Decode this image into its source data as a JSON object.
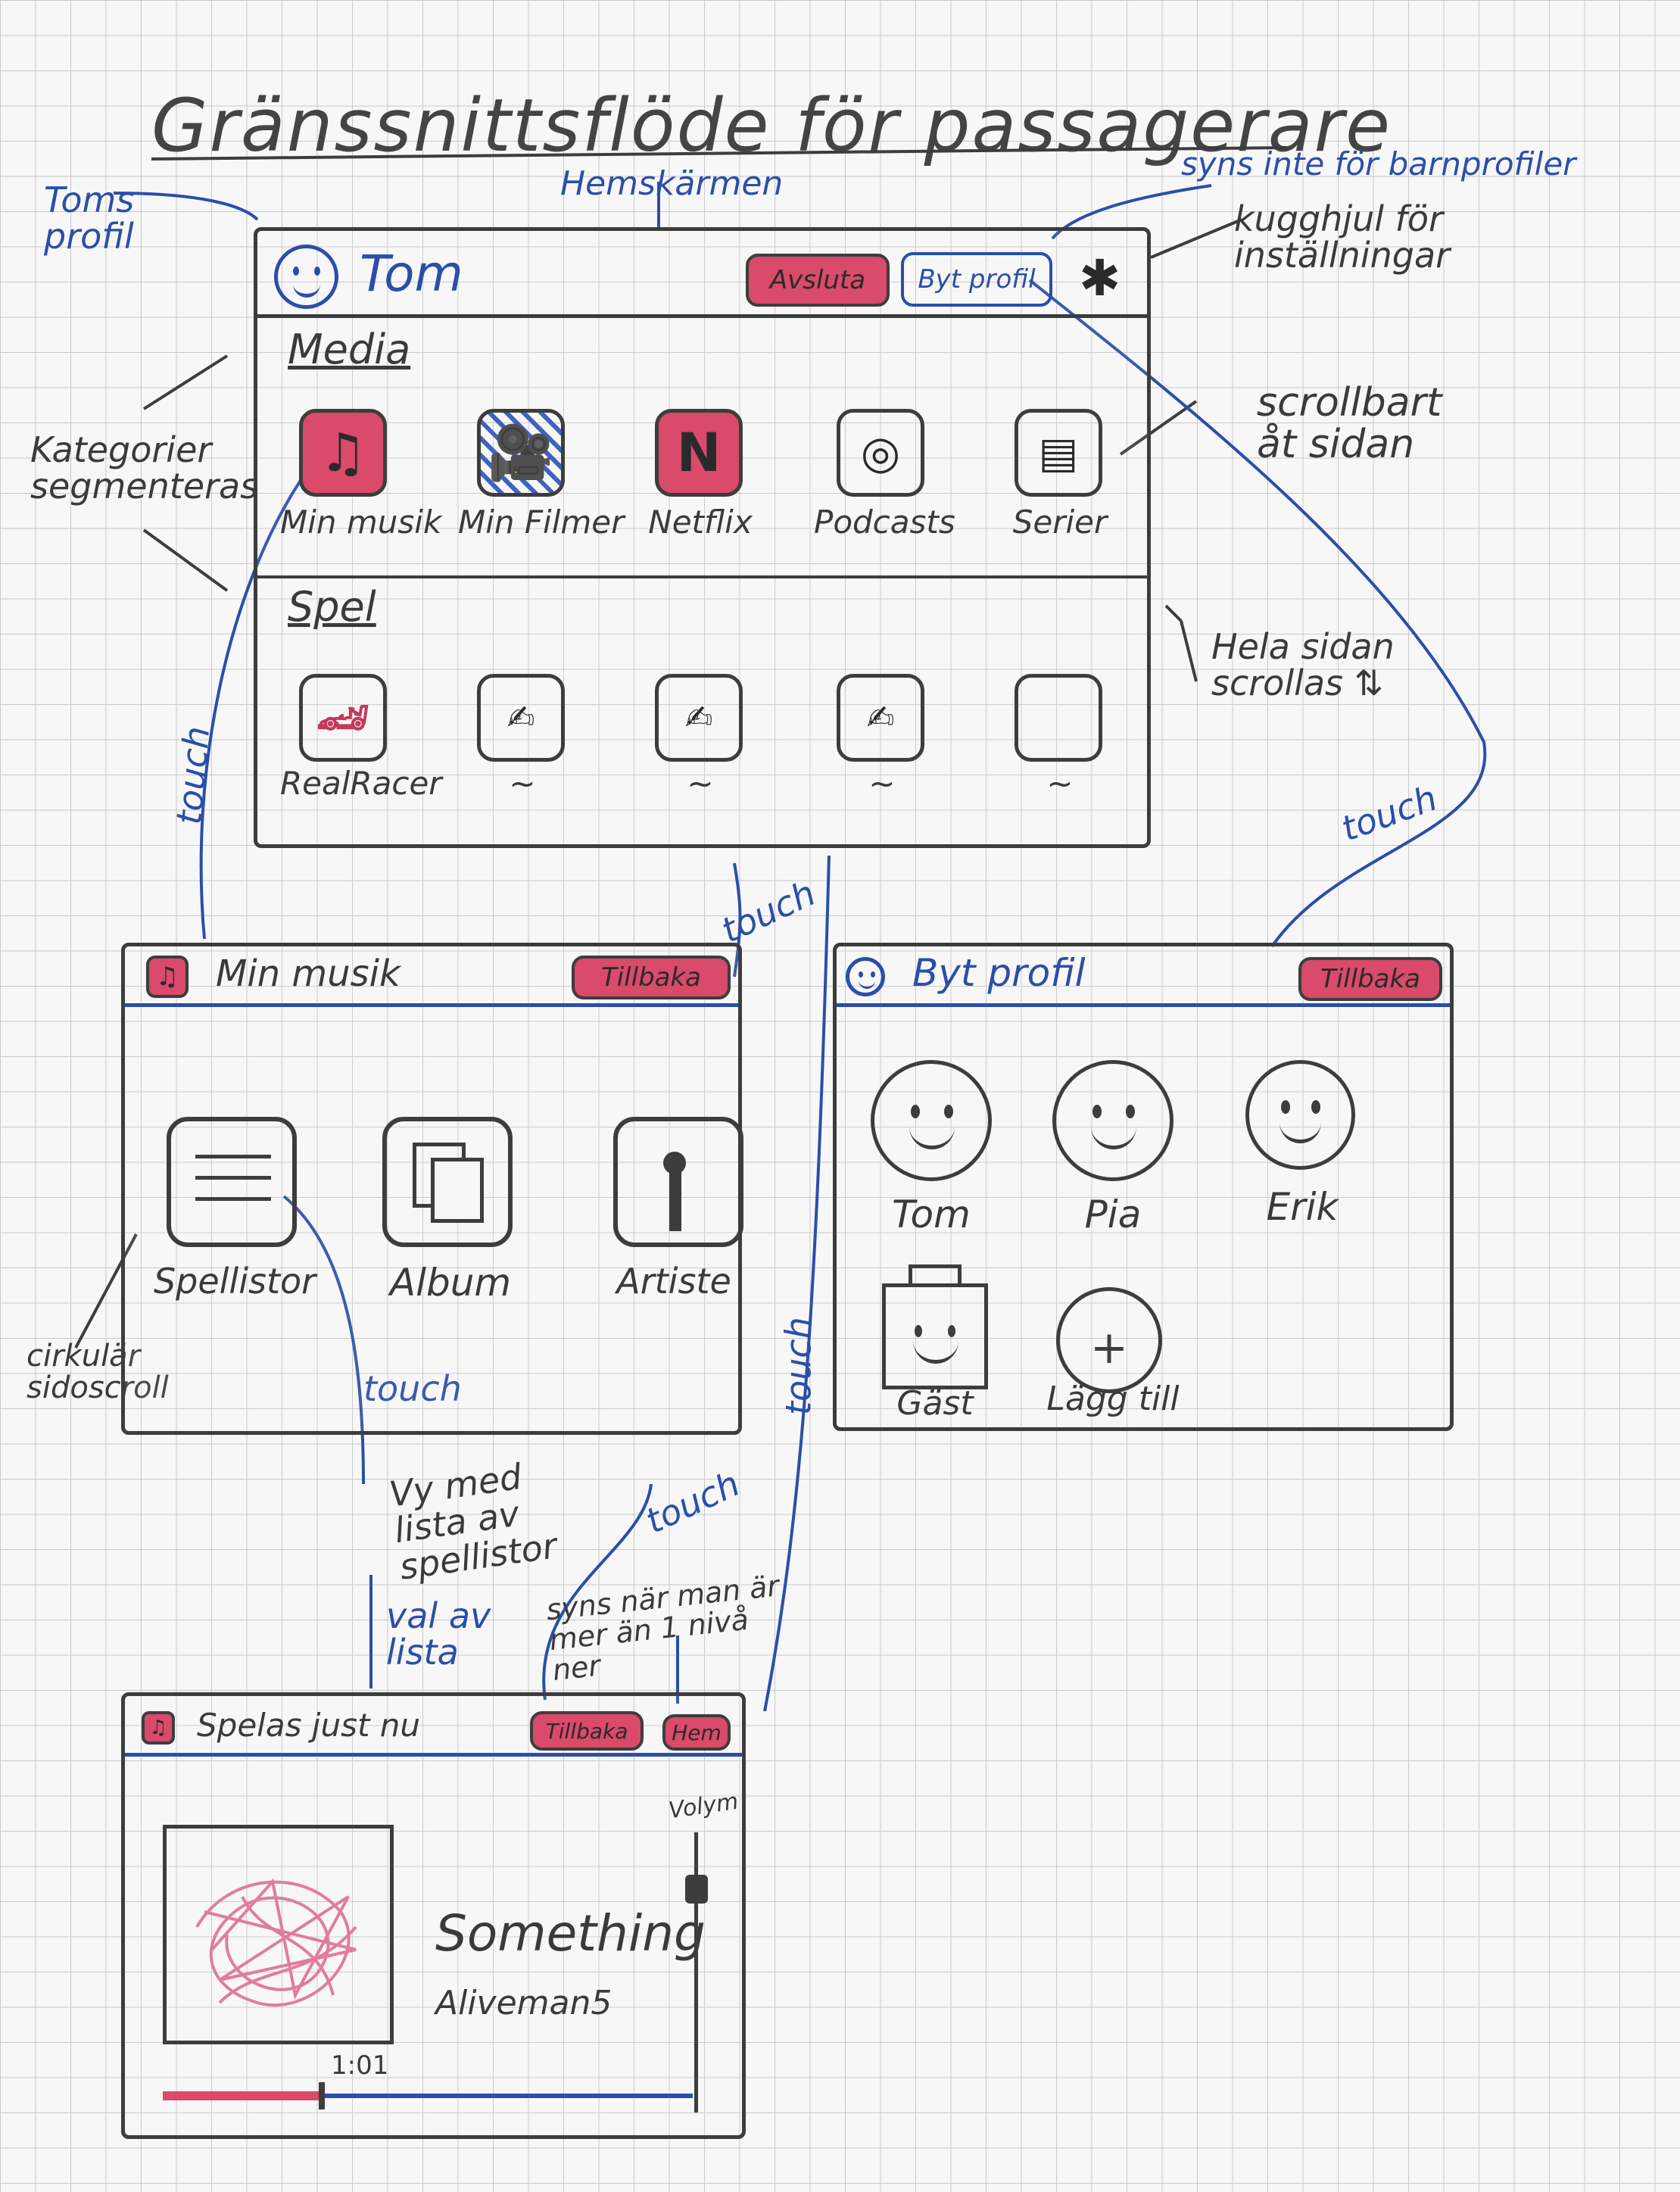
{
  "title": "Gränssnittsflöde för passagerare",
  "annotations": {
    "toms_profil": "Toms profil",
    "hemskarmen": "Hemskärmen",
    "syns_inte": "syns inte för barnprofiler",
    "kugghjul": "kugghjul för inställningar",
    "scrollbart": "scrollbart åt sidan",
    "kategorier": "Kategorier segmenteras",
    "hela_sidan": "Hela sidan scrollas ⇅",
    "touch": "touch",
    "cirkular": "cirkulär sidoscroll",
    "vy_med_lista": "Vy med lista av spellistor",
    "val_av_lista": "val av lista",
    "syns_nar": "syns när man är mer än 1 nivå ner"
  },
  "home": {
    "user": "Tom",
    "avsluta": "Avsluta",
    "byt_profil": "Byt profil",
    "settings_icon": "gear-icon",
    "media_title": "Media",
    "media": [
      "Min musik",
      "Min Filmer",
      "Netflix",
      "Podcasts",
      "Serier"
    ],
    "spel_title": "Spel",
    "spel": [
      "RealRacer",
      "~",
      "~",
      "~",
      "~"
    ]
  },
  "music": {
    "title": "Min musik",
    "back": "Tillbaka",
    "items": [
      "Spellistor",
      "Album",
      "Artiste"
    ]
  },
  "profiles": {
    "title": "Byt profil",
    "back": "Tillbaka",
    "items": [
      "Tom",
      "Pia",
      "Erik",
      "Gäst",
      "Lägg till"
    ]
  },
  "playing": {
    "title": "Spelas just nu",
    "back": "Tillbaka",
    "hem": "Hem",
    "song": "Something",
    "artist": "Aliveman5",
    "time": "1:01",
    "volume": "Volym",
    "progress": 0.3,
    "volume_level": 0.85
  },
  "colors": {
    "accent": "#d94a6b",
    "ink_blue": "#2b4ea8",
    "ink": "#3d3d3d"
  }
}
